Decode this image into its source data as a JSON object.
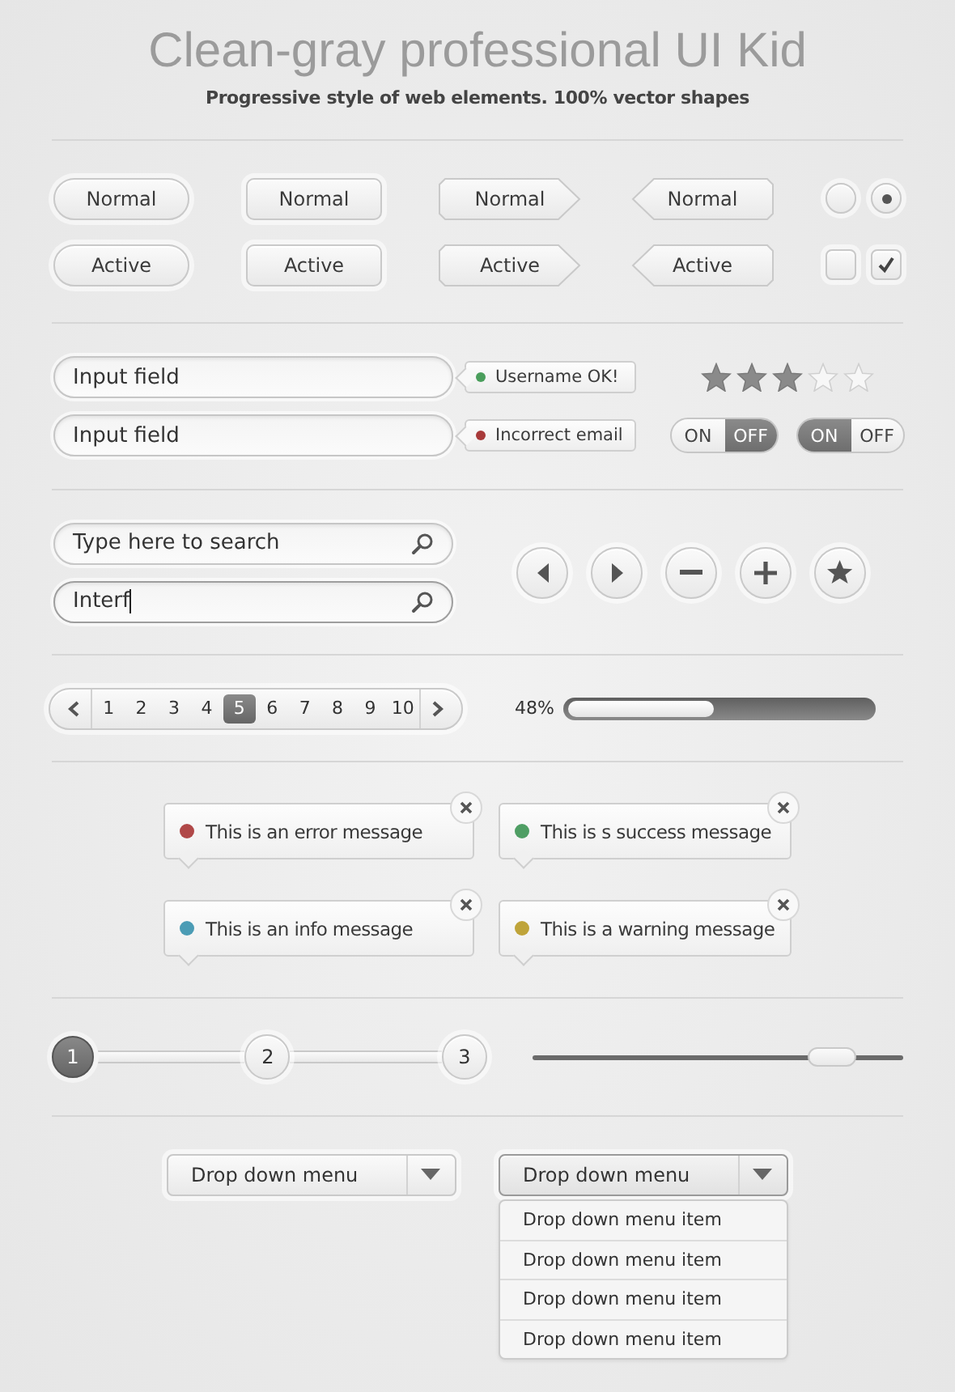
{
  "header": {
    "title": "Clean-gray professional UI Kid",
    "subtitle": "Progressive style of web elements. 100% vector shapes"
  },
  "button_rows": [
    {
      "buttons": [
        {
          "label": "Normal",
          "kind": "pill"
        },
        {
          "label": "Normal",
          "kind": "rounded"
        },
        {
          "label": "Normal",
          "kind": "arrow-right"
        },
        {
          "label": "Normal",
          "kind": "arrow-left"
        }
      ],
      "toggles": [
        {
          "kind": "radio",
          "checked": false
        },
        {
          "kind": "radio",
          "checked": true
        }
      ]
    },
    {
      "buttons": [
        {
          "label": "Active",
          "kind": "pill"
        },
        {
          "label": "Active",
          "kind": "rounded"
        },
        {
          "label": "Active",
          "kind": "arrow-right"
        },
        {
          "label": "Active",
          "kind": "arrow-left"
        }
      ],
      "toggles": [
        {
          "kind": "checkbox",
          "checked": false
        },
        {
          "kind": "checkbox",
          "checked": true
        }
      ]
    }
  ],
  "inputs": [
    {
      "value": "Input field",
      "status": {
        "text": "Username OK!",
        "color": "#4a9e5c"
      }
    },
    {
      "value": "Input field",
      "status": {
        "text": "Incorrect email",
        "color": "#a83a3a"
      }
    }
  ],
  "rating": {
    "stars": 3
  },
  "switches": [
    {
      "on_label": "ON",
      "off_label": "OFF",
      "on": false
    },
    {
      "on_label": "ON",
      "off_label": "OFF",
      "on": true
    }
  ],
  "search_fields": [
    {
      "placeholder": "Type here to search",
      "focused": false
    },
    {
      "value": "Interf",
      "focused": true
    }
  ],
  "round_buttons": [
    {
      "kind": "previous"
    },
    {
      "kind": "next"
    },
    {
      "kind": "minus"
    },
    {
      "kind": "plus"
    },
    {
      "kind": "star"
    }
  ],
  "pagination": {
    "pages": [
      {
        "label": "1",
        "selected": false
      },
      {
        "label": "2",
        "selected": false
      },
      {
        "label": "3",
        "selected": false
      },
      {
        "label": "4",
        "selected": false
      },
      {
        "label": "5",
        "selected": true
      },
      {
        "label": "6",
        "selected": false
      },
      {
        "label": "7",
        "selected": false
      },
      {
        "label": "8",
        "selected": false
      },
      {
        "label": "9",
        "selected": false
      },
      {
        "label": "10",
        "selected": false
      }
    ]
  },
  "progress": {
    "reading": "48%",
    "level": 0.48
  },
  "messages": [
    {
      "text": "This is an error message",
      "color": "#b04848"
    },
    {
      "text": "This is s success message",
      "color": "#4f9e64"
    },
    {
      "text": "This is an info message",
      "color": "#4b9cb5"
    },
    {
      "text": "This is a warning message",
      "color": "#bfa43a"
    }
  ],
  "stepper": {
    "steps": [
      {
        "label": "1",
        "selected": true
      },
      {
        "label": "2",
        "selected": false
      },
      {
        "label": "3",
        "selected": false
      }
    ]
  },
  "slider": {
    "level": 0.81
  },
  "dropdowns": [
    {
      "label": "Drop down menu",
      "expanded": false
    },
    {
      "label": "Drop down menu",
      "expanded": true,
      "items": [
        "Drop down menu item",
        "Drop down menu item",
        "Drop down menu item",
        "Drop down menu item"
      ]
    }
  ]
}
